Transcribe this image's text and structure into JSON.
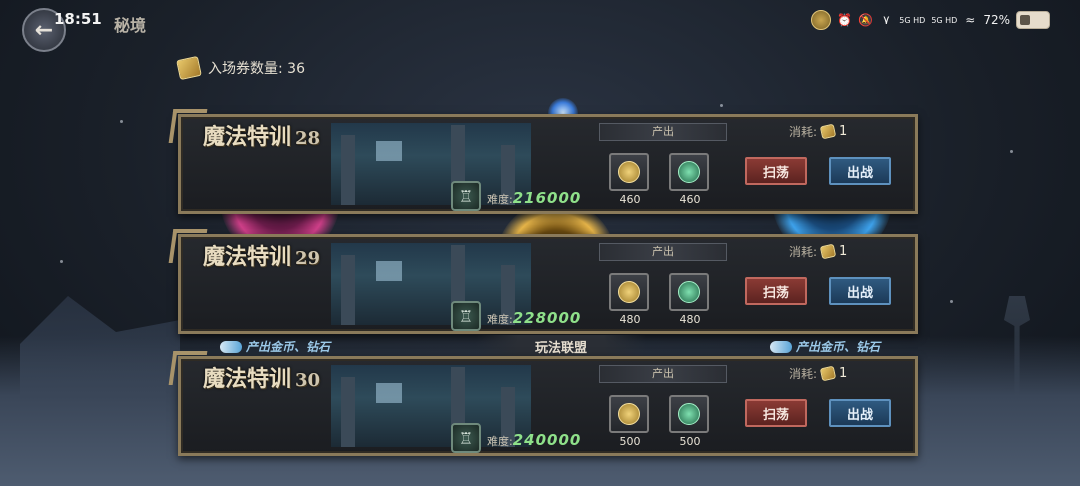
{
  "status_bar": {
    "time": "18:51",
    "page_title": "秘境",
    "network_1": "5G HD",
    "network_2": "5G HD",
    "battery_percent": "72%"
  },
  "ticket": {
    "label": "入场券数量: 36"
  },
  "cards": [
    {
      "title": "魔法特训",
      "level": "28",
      "difficulty_label": "难度:",
      "difficulty_value": "216000",
      "output_label": "产出",
      "gold_qty": "460",
      "gem_qty": "460",
      "cost_label": "消耗:",
      "cost_value": "1",
      "sweep_label": "扫荡",
      "fight_label": "出战"
    },
    {
      "title": "魔法特训",
      "level": "29",
      "difficulty_label": "难度:",
      "difficulty_value": "228000",
      "output_label": "产出",
      "gold_qty": "480",
      "gem_qty": "480",
      "cost_label": "消耗:",
      "cost_value": "1",
      "sweep_label": "扫荡",
      "fight_label": "出战"
    },
    {
      "title": "魔法特训",
      "level": "30",
      "difficulty_label": "难度:",
      "difficulty_value": "240000",
      "output_label": "产出",
      "gold_qty": "500",
      "gem_qty": "500",
      "cost_label": "消耗:",
      "cost_value": "1",
      "sweep_label": "扫荡",
      "fight_label": "出战"
    }
  ],
  "tags": {
    "left": "产出金币、钻石",
    "right": "产出金币、钻石",
    "alliance": "玩法联盟"
  },
  "colors": {
    "frame": "#8a7a5a",
    "difficulty": "#8fe08a",
    "sweep_button": "#8a3a34",
    "fight_button": "#2f5a80"
  }
}
